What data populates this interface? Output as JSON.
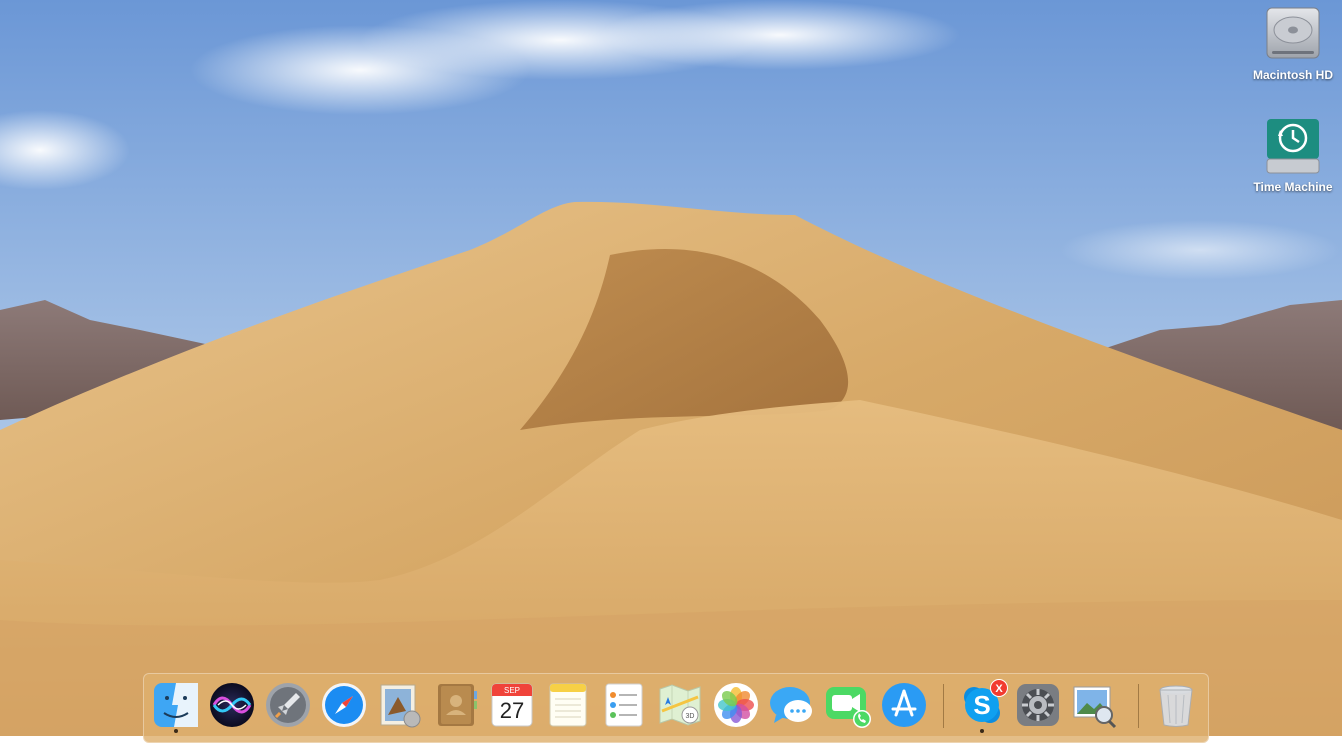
{
  "desktop": {
    "icons": [
      {
        "label": "Macintosh HD",
        "icon": "hard-drive-icon"
      },
      {
        "label": "Time Machine",
        "icon": "time-machine-drive-icon"
      }
    ]
  },
  "dock": {
    "apps": [
      {
        "name": "Finder",
        "icon": "finder-icon",
        "running": true
      },
      {
        "name": "Siri",
        "icon": "siri-icon"
      },
      {
        "name": "Launchpad",
        "icon": "launchpad-icon"
      },
      {
        "name": "Safari",
        "icon": "safari-icon"
      },
      {
        "name": "Mail",
        "icon": "mail-icon"
      },
      {
        "name": "Contacts",
        "icon": "contacts-icon"
      },
      {
        "name": "Calendar",
        "icon": "calendar-icon",
        "month": "SEP",
        "day": "27"
      },
      {
        "name": "Notes",
        "icon": "notes-icon"
      },
      {
        "name": "Reminders",
        "icon": "reminders-icon"
      },
      {
        "name": "Maps",
        "icon": "maps-icon"
      },
      {
        "name": "Photos",
        "icon": "photos-icon"
      },
      {
        "name": "Messages",
        "icon": "messages-icon"
      },
      {
        "name": "FaceTime",
        "icon": "facetime-icon"
      },
      {
        "name": "App Store",
        "icon": "app-store-icon"
      }
    ],
    "recent": [
      {
        "name": "Skype",
        "icon": "skype-icon",
        "badge": "X",
        "running": true
      },
      {
        "name": "System Preferences",
        "icon": "system-preferences-icon"
      },
      {
        "name": "Preview",
        "icon": "preview-icon"
      }
    ],
    "trash": {
      "name": "Trash",
      "icon": "trash-icon"
    }
  },
  "colors": {
    "sky": "#7fa7dc",
    "sand": "#d9ae6f",
    "dock_tint": "#deb06e",
    "badge": "#f23b30"
  }
}
